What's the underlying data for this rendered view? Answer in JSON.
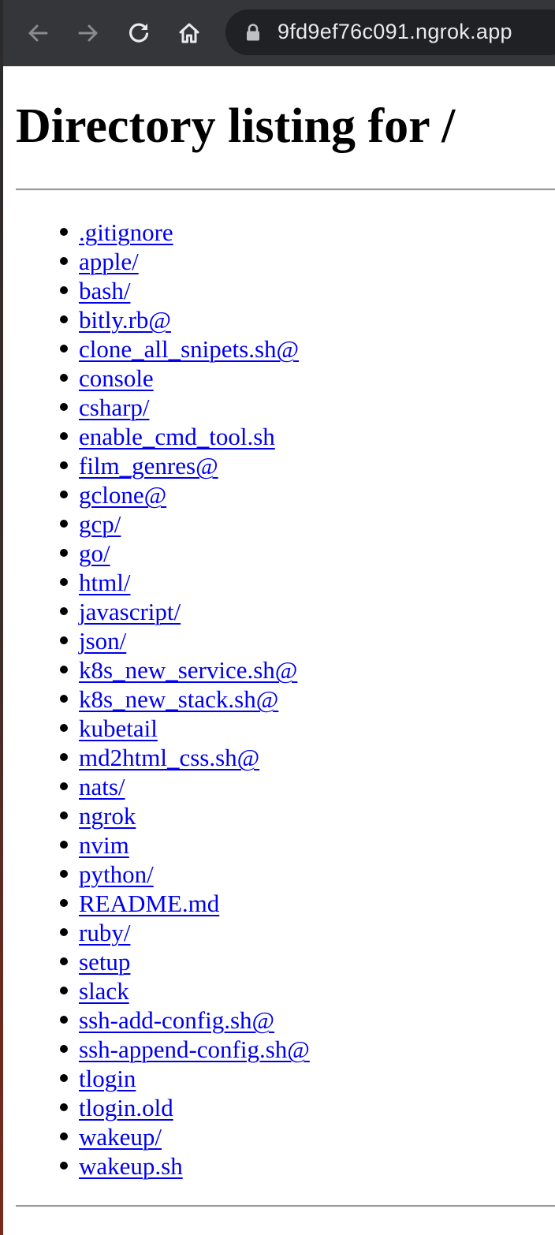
{
  "browser": {
    "url": "9fd9ef76c091.ngrok.app",
    "back_icon": "arrow-left-icon",
    "forward_icon": "arrow-right-icon",
    "reload_icon": "reload-icon",
    "home_icon": "home-icon",
    "lock_icon": "lock-icon"
  },
  "page": {
    "title": "Directory listing for /",
    "link_color": "#0000ee",
    "entries": [
      ".gitignore",
      "apple/",
      "bash/",
      "bitly.rb@",
      "clone_all_snipets.sh@",
      "console",
      "csharp/",
      "enable_cmd_tool.sh",
      "film_genres@",
      "gclone@",
      "gcp/",
      "go/",
      "html/",
      "javascript/",
      "json/",
      "k8s_new_service.sh@",
      "k8s_new_stack.sh@",
      "kubetail",
      "md2html_css.sh@",
      "nats/",
      "ngrok",
      "nvim",
      "python/",
      "README.md",
      "ruby/",
      "setup",
      "slack",
      "ssh-add-config.sh@",
      "ssh-append-config.sh@",
      "tlogin",
      "tlogin.old",
      "wakeup/",
      "wakeup.sh"
    ]
  }
}
